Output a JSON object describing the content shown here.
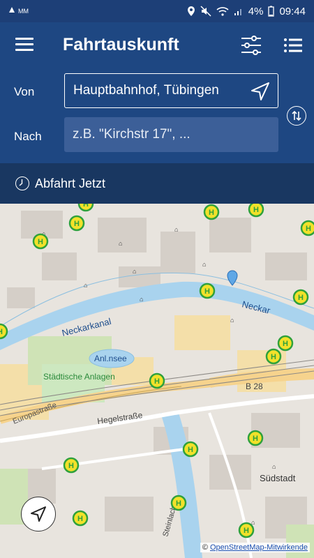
{
  "status_bar": {
    "left_icon_label": "MM",
    "battery": "4%",
    "time": "09:44"
  },
  "app_bar": {
    "title": "Fahrtauskunft",
    "icons": [
      "menu-icon",
      "filter-sliders-icon",
      "list-icon"
    ]
  },
  "route": {
    "from_label": "Von",
    "from_value": "Hauptbahnhof, Tübingen",
    "to_label": "Nach",
    "to_placeholder": "z.B. \"Kirchstr 17\", ..."
  },
  "departure": {
    "label": "Abfahrt Jetzt"
  },
  "map": {
    "labels": {
      "river": "Neckar",
      "canal": "Neckarkanal",
      "lake": "Anl.nsee",
      "park": "Städtische Anlagen",
      "street1": "Europastraße",
      "street2": "Hegelstraße",
      "road": "B 28",
      "district": "Südstadt",
      "street3": "Steinlach"
    },
    "attribution_prefix": "©",
    "attribution_link": "OpenStreetMap-Mitwirkende"
  },
  "colors": {
    "header": "#1e4782",
    "statusbar": "#1d3f77",
    "timebar": "#193761",
    "stop_yellow": "#f2e12a",
    "stop_green": "#2fa13c",
    "water": "#a9d3ee",
    "road_yellow": "#f6d38d"
  }
}
